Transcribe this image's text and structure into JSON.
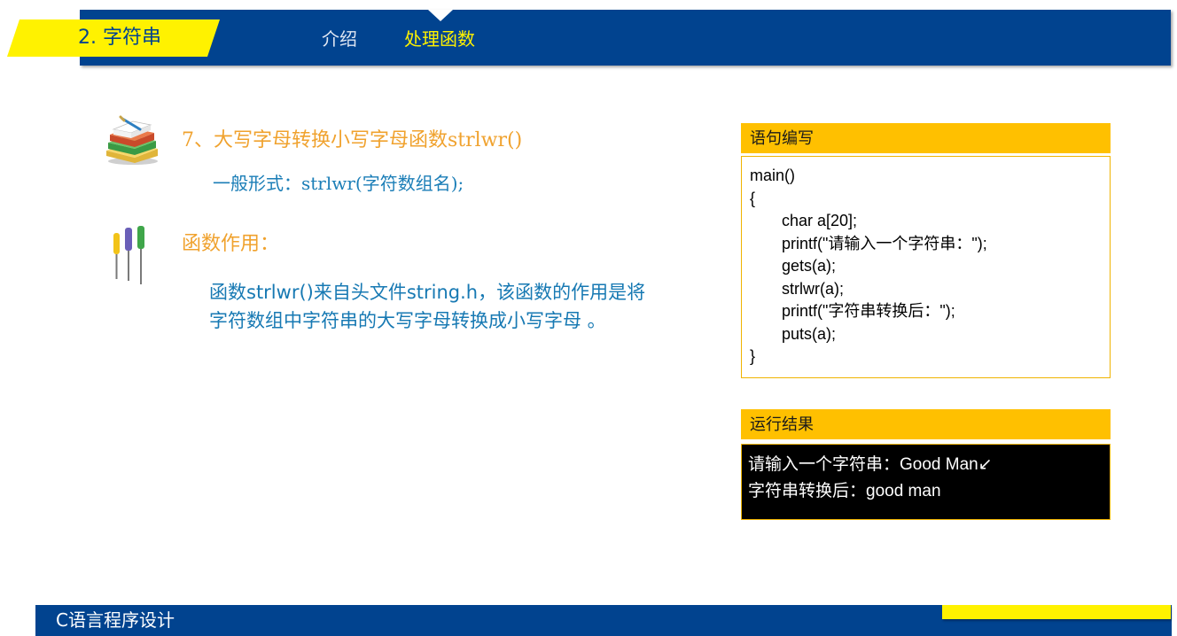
{
  "header": {
    "title": "2. 字符串",
    "nav": [
      {
        "label": "介绍"
      },
      {
        "label": "处理函数"
      }
    ]
  },
  "section": {
    "heading": "7、大写字母转换小写字母函数strlwr()",
    "general_form": "一般形式：strlwr(字符数组名);",
    "purpose_heading": "函数作用：",
    "description_lines": [
      "函数strlwr()来自头文件string.h，该函数的作用是将",
      "字符数组中字符串的大写字母转换成小写字母 。"
    ]
  },
  "code_panel": {
    "title": "语句编写",
    "lines": [
      "main()",
      "{",
      "char a[20];",
      "printf(\"请输入一个字符串：\");",
      "gets(a);",
      "strlwr(a);",
      "printf(\"字符串转换后：\");",
      "puts(a);",
      "}"
    ]
  },
  "result_panel": {
    "title": "运行结果",
    "lines": [
      "请输入一个字符串：Good Man↙",
      "字符串转换后：good man"
    ]
  },
  "footer": {
    "text": "C语言程序设计"
  },
  "icons": {
    "books": "books-icon",
    "tools": "screwdrivers-icon"
  },
  "colors": {
    "brand_blue": "#01438f",
    "accent_yellow": "#fff200",
    "panel_header": "#ffc000",
    "heading_orange": "#f0a22e",
    "body_blue": "#1779b3"
  }
}
